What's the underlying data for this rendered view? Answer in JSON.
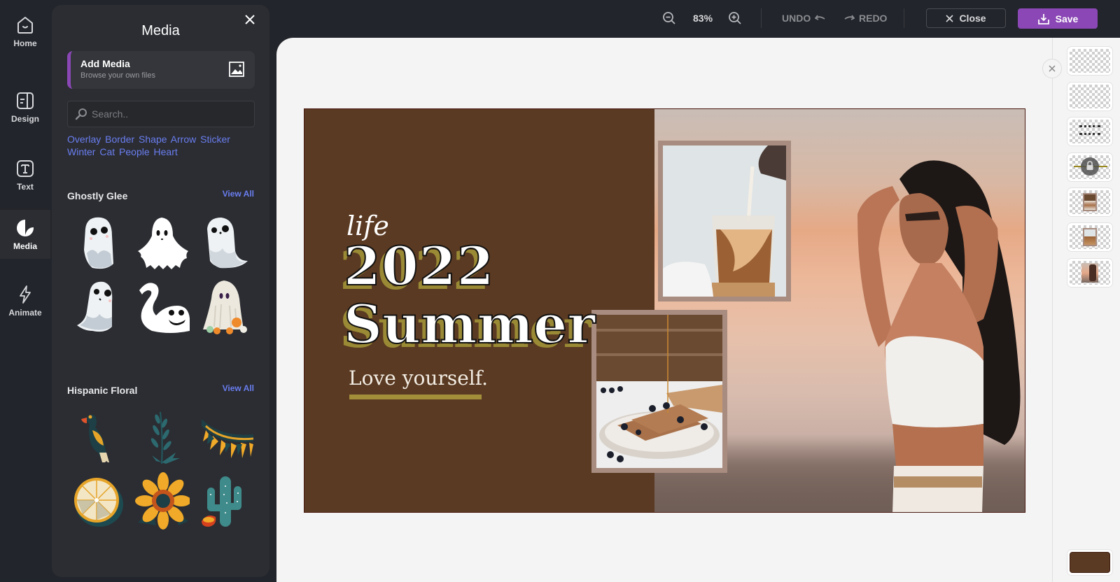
{
  "rail": {
    "items": [
      {
        "label": "Home",
        "icon": "home-icon"
      },
      {
        "label": "Design",
        "icon": "design-layout-icon"
      },
      {
        "label": "Text",
        "icon": "text-icon"
      },
      {
        "label": "Media",
        "icon": "media-sticker-icon",
        "active": true
      },
      {
        "label": "Animate",
        "icon": "lightning-icon"
      }
    ]
  },
  "panel": {
    "title": "Media",
    "close_icon": "close-icon",
    "add_media": {
      "title": "Add Media",
      "subtitle": "Browse your own files",
      "icon": "image-icon"
    },
    "search": {
      "placeholder": "Search..",
      "value": ""
    },
    "tags": [
      "Overlay",
      "Border",
      "Shape",
      "Arrow",
      "Sticker",
      "Winter",
      "Cat",
      "People",
      "Heart"
    ],
    "sections": [
      {
        "title": "Ghostly Glee",
        "view_all": "View All",
        "items": [
          "ghost-chubby-sticker",
          "ghost-sheet-sticker",
          "ghost-wavy-sticker",
          "ghost-leaning-sticker",
          "ghost-swan-sticker",
          "ghost-pumpkins-sticker"
        ]
      },
      {
        "title": "Hispanic Floral",
        "view_all": "View All",
        "items": [
          "parrot-sticker",
          "leaf-branch-sticker",
          "papel-garland-sticker",
          "citrus-slice-sticker",
          "sunflower-sticker",
          "cactus-sticker"
        ]
      }
    ]
  },
  "toolbar": {
    "zoom_out_icon": "zoom-out-icon",
    "zoom_level": "83%",
    "zoom_in_icon": "zoom-in-icon",
    "undo_label": "UNDO",
    "redo_label": "REDO",
    "close_label": "Close",
    "save_label": "Save"
  },
  "canvas": {
    "background_color": "#5a3a22",
    "text_life": "life",
    "text_year": "2022",
    "text_summer": "Summer",
    "text_tagline": "Love yourself.",
    "accent_color": "#a38f3a",
    "images": [
      "iced-coffee-photo",
      "waffles-photo",
      "woman-sunset-photo"
    ]
  },
  "layers": {
    "close_icon": "close-icon",
    "items": [
      "layer-1",
      "layer-2",
      "layer-text-2022-summer",
      "layer-underline-locked",
      "layer-waffles",
      "layer-coffee",
      "layer-woman"
    ],
    "background_swatch": "#5a3a22"
  },
  "colors": {
    "brand_purple": "#8a47b5",
    "link_blue": "#6a7df0"
  }
}
